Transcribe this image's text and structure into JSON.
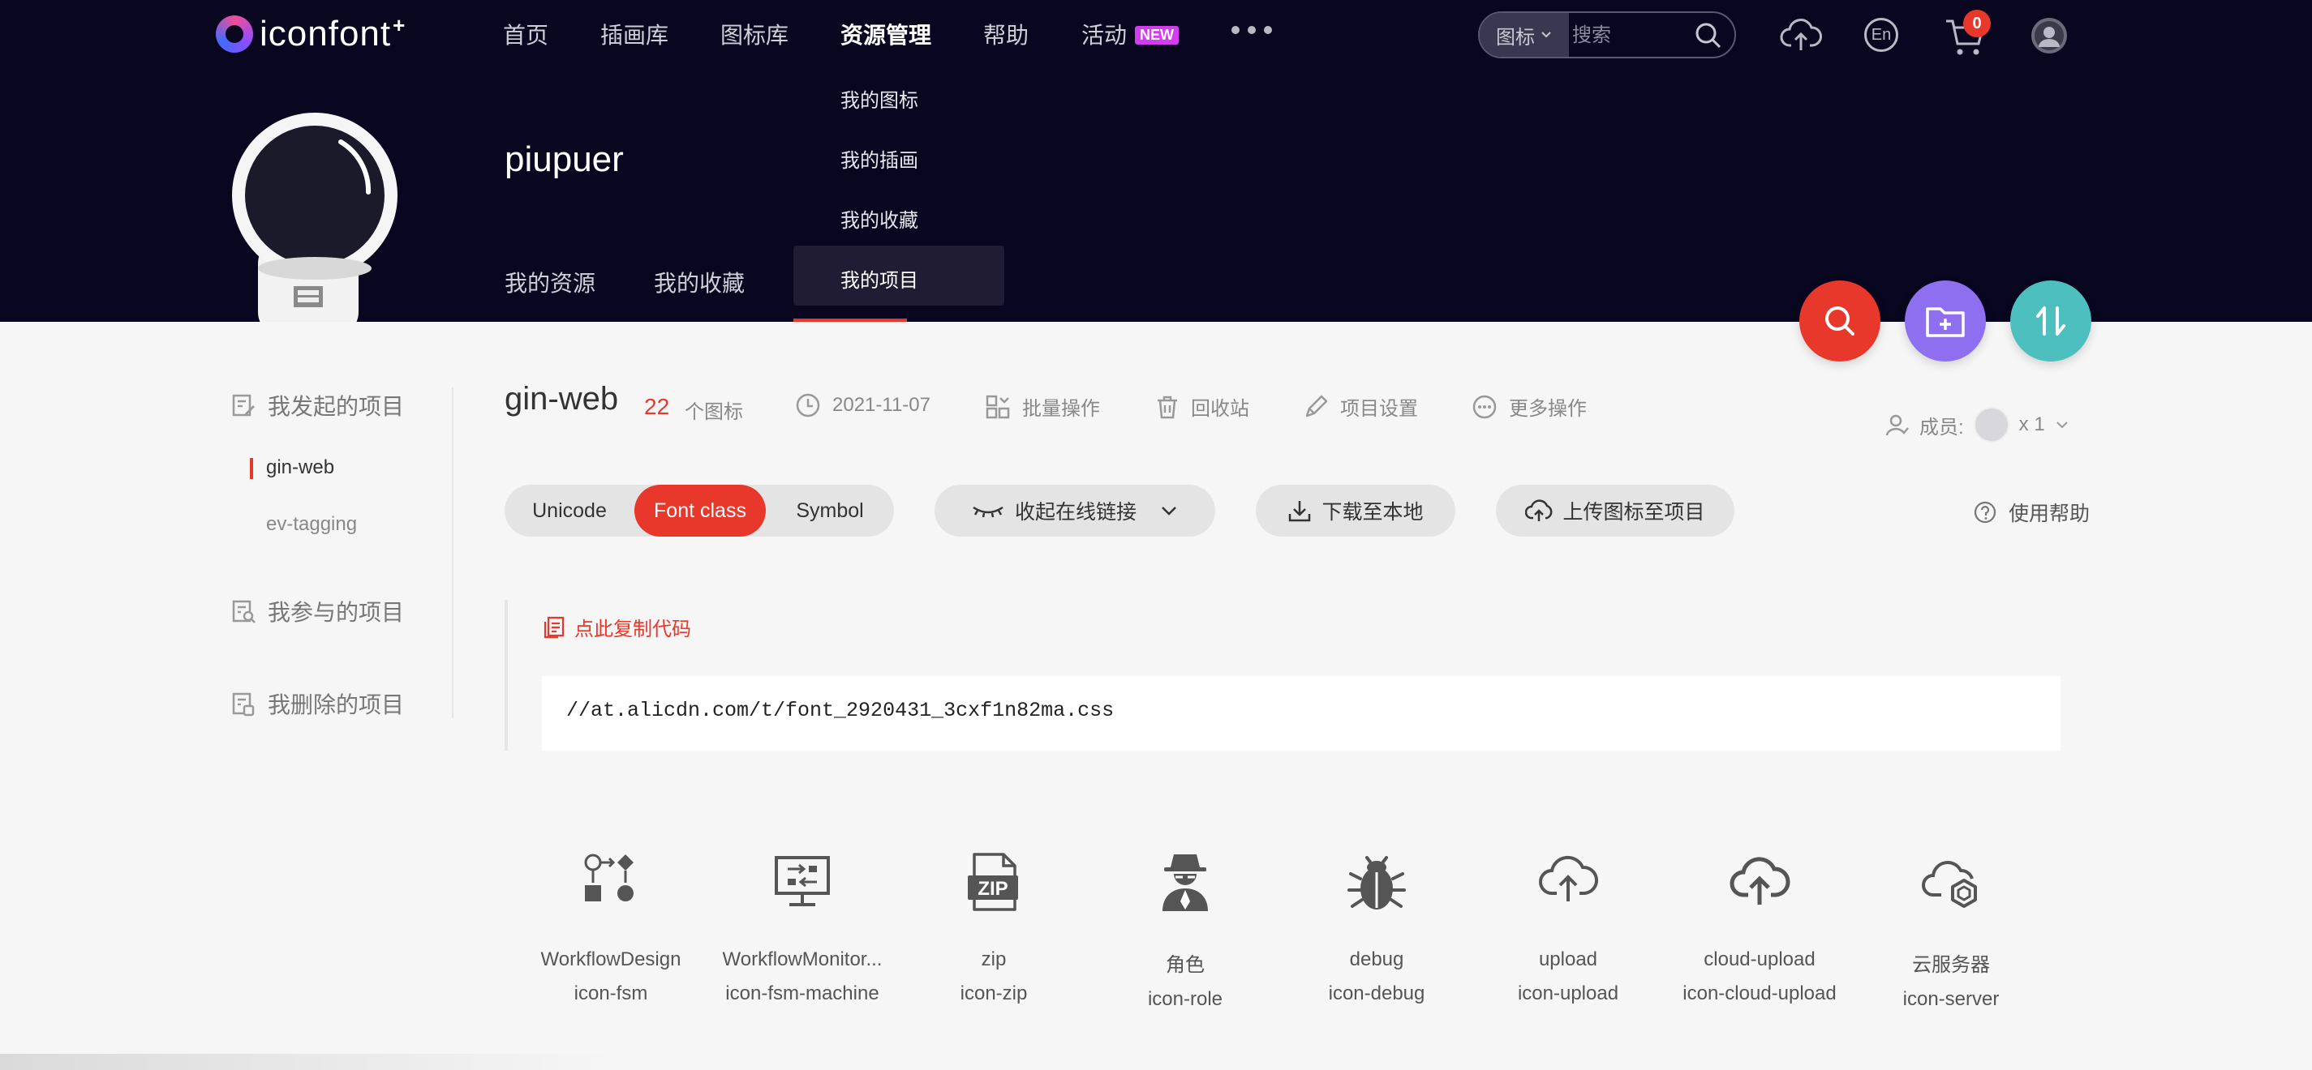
{
  "brand": {
    "name": "iconfont",
    "suffix": "+"
  },
  "nav": {
    "items": [
      "首页",
      "插画库",
      "图标库",
      "资源管理",
      "帮助",
      "活动"
    ],
    "active": "资源管理",
    "new_badge": "NEW"
  },
  "search": {
    "type": "图标",
    "placeholder": "搜索"
  },
  "header_icons": {
    "upload": "cloud-upload-icon",
    "language": "En",
    "cart_count": "0",
    "user": "user-avatar-icon"
  },
  "dropdown": {
    "items": [
      "我的图标",
      "我的插画",
      "我的收藏",
      "我的项目"
    ],
    "active_index": 3
  },
  "profile": {
    "username": "piupuer",
    "tabs": [
      "我的资源",
      "我的收藏"
    ]
  },
  "fab": {
    "search_color": "#e8382b",
    "folder_color": "#8e6ff0",
    "sort_color": "#4dbfbf"
  },
  "sidebar": {
    "groups": [
      {
        "label": "我发起的项目",
        "icon": "edit-doc-icon"
      },
      {
        "label": "我参与的项目",
        "icon": "search-doc-icon"
      },
      {
        "label": "我删除的项目",
        "icon": "trash-doc-icon"
      }
    ],
    "projects": [
      "gin-web",
      "ev-tagging"
    ],
    "active_project": "gin-web"
  },
  "project": {
    "name": "gin-web",
    "icon_count": "22",
    "icon_count_unit": "个图标",
    "date": "2021-11-07",
    "actions": [
      "批量操作",
      "回收站",
      "项目设置",
      "更多操作"
    ],
    "members_label": "成员:",
    "members_count": "x 1"
  },
  "toolbar": {
    "modes": [
      "Unicode",
      "Font class",
      "Symbol"
    ],
    "active_mode": "Font class",
    "collapse_link": "收起在线链接",
    "download": "下载至本地",
    "upload": "上传图标至项目",
    "help": "使用帮助"
  },
  "code": {
    "copy_label": "点此复制代码",
    "url": "//at.alicdn.com/t/font_2920431_3cxf1n82ma.css"
  },
  "icons": [
    {
      "name": "WorkflowDesign",
      "class": "icon-fsm"
    },
    {
      "name": "WorkflowMonitor...",
      "class": "icon-fsm-machine"
    },
    {
      "name": "zip",
      "class": "icon-zip"
    },
    {
      "name": "角色",
      "class": "icon-role"
    },
    {
      "name": "debug",
      "class": "icon-debug"
    },
    {
      "name": "upload",
      "class": "icon-upload"
    },
    {
      "name": "cloud-upload",
      "class": "icon-cloud-upload"
    },
    {
      "name": "云服务器",
      "class": "icon-server"
    }
  ],
  "colors": {
    "header_bg": "#09061f",
    "accent_red": "#e8382b",
    "page_bg": "#f6f6f6"
  }
}
